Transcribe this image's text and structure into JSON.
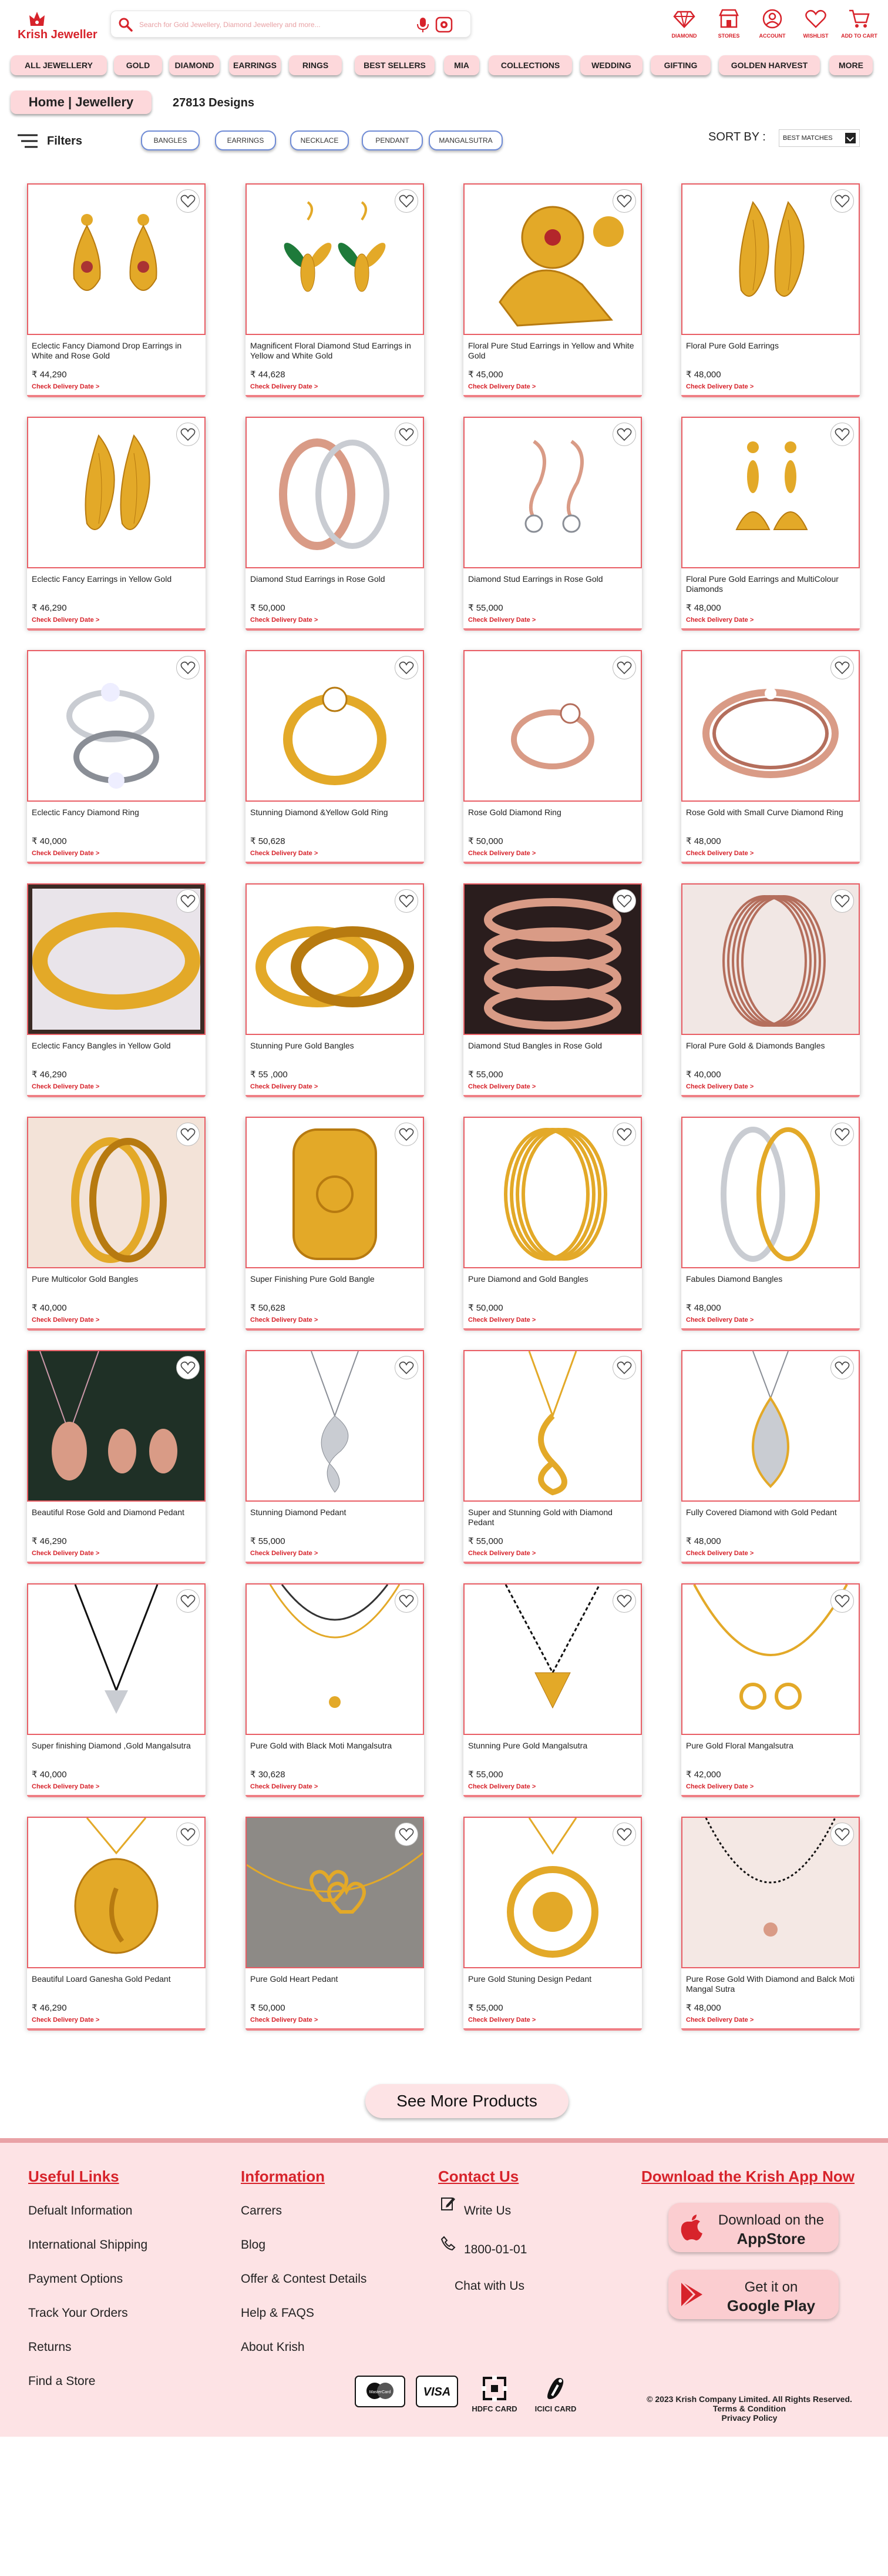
{
  "header": {
    "logo_text": "Krish Jeweller",
    "search_placeholder": "Search for Gold Jewellery, Diamond Jewellery and more...",
    "nav": [
      {
        "label": "DIAMOND",
        "icon": "diamond-icon"
      },
      {
        "label": "STORES",
        "icon": "store-icon"
      },
      {
        "label": "ACCOUNT",
        "icon": "account-icon"
      },
      {
        "label": "WISHLIST",
        "icon": "heart-icon"
      },
      {
        "label": "ADD TO CART",
        "icon": "cart-icon"
      }
    ]
  },
  "categories": [
    "ALL JEWELLERY",
    "GOLD",
    "DIAMOND",
    "EARRINGS",
    "RINGS",
    "BEST SELLERS",
    "MIA",
    "COLLECTIONS",
    "WEDDING",
    "GIFTING",
    "GOLDEN HARVEST",
    "MORE"
  ],
  "breadcrumb": "Home | Jewellery",
  "designs_count": "27813 Designs",
  "filters": {
    "label": "Filters",
    "chips": [
      "BANGLES",
      "EARRINGS",
      "NECKLACE",
      "PENDANT",
      "MANGALSUTRA"
    ]
  },
  "sort": {
    "label": "SORT BY :",
    "selected": "BEST MATCHES"
  },
  "delivery_text": "Check Delivery Date >",
  "currency": "₹",
  "products": [
    {
      "name": "Eclectic Fancy Diamond Drop Earrings in White and Rose Gold",
      "price": "44,290",
      "type": "earring-drop",
      "bg": "#ffffff"
    },
    {
      "name": "Magnificent Floral Diamond Stud Earrings in Yellow and White Gold",
      "price": "44,628",
      "type": "earring-leaf",
      "bg": "#ffffff"
    },
    {
      "name": "Floral Pure Stud Earrings in Yellow and White Gold",
      "price": "45,000",
      "type": "earring-jhumka",
      "bg": "#ffffff"
    },
    {
      "name": "Floral Pure Gold Earrings",
      "price": "48,000",
      "type": "earring-feather",
      "bg": "#ffffff"
    },
    {
      "name": "Eclectic Fancy Earrings in Yellow Gold",
      "price": "46,290",
      "type": "earring-feather",
      "bg": "#ffffff"
    },
    {
      "name": "Diamond Stud Earrings in Rose Gold",
      "price": "50,000",
      "type": "earring-hoop",
      "bg": "#ffffff"
    },
    {
      "name": "Diamond Stud Earrings in Rose Gold",
      "price": "55,000",
      "type": "earring-hook",
      "bg": "#ffffff"
    },
    {
      "name": "Floral Pure Gold Earrings and MultiColour Diamonds",
      "price": "48,000",
      "type": "earring-jhumka-small",
      "bg": "#ffffff"
    },
    {
      "name": "Eclectic Fancy Diamond Ring",
      "price": "40,000",
      "type": "ring-silver",
      "bg": "#ffffff"
    },
    {
      "name": "Stunning Diamond &Yellow Gold Ring",
      "price": "50,628",
      "type": "ring-gold",
      "bg": "#ffffff"
    },
    {
      "name": "Rose Gold Diamond Ring",
      "price": "50,000",
      "type": "ring-rose",
      "bg": "#ffffff"
    },
    {
      "name": "Rose Gold with Small Curve Diamond Ring",
      "price": "48,000",
      "type": "ring-rose-band",
      "bg": "#ffffff"
    },
    {
      "name": "Eclectic Fancy Bangles in Yellow Gold",
      "price": "46,290",
      "type": "bangle-dark",
      "bg": "#e9e4ea"
    },
    {
      "name": "Stunning Pure Gold Bangles",
      "price": "55 ,000",
      "type": "bangle-pair",
      "bg": "#ffffff"
    },
    {
      "name": "Diamond Stud Bangles in Rose Gold",
      "price": "55,000",
      "type": "bangle-rose-stack",
      "bg": "#2a1d1d"
    },
    {
      "name": "Floral Pure Gold & Diamonds Bangles",
      "price": "40,000",
      "type": "bangle-rose-thin",
      "bg": "#f1e7e4"
    },
    {
      "name": "Pure Multicolor Gold Bangles",
      "price": "40,000",
      "type": "bangle-pair-soft",
      "bg": "#f3e3d8"
    },
    {
      "name": "Super Finishing Pure Gold Bangle",
      "price": "50,628",
      "type": "bangle-wide",
      "bg": "#ffffff"
    },
    {
      "name": "Pure Diamond  and Gold Bangles",
      "price": "50,000",
      "type": "bangle-stack",
      "bg": "#ffffff"
    },
    {
      "name": "Fabules Diamond Bangles",
      "price": "48,000",
      "type": "bangle-diamond",
      "bg": "#ffffff"
    },
    {
      "name": "Beautiful Rose Gold and Diamond Pedant",
      "price": "46,290",
      "type": "pendant-dark",
      "bg": "#1f3026"
    },
    {
      "name": "Stunning Diamond Pedant",
      "price": "55,000",
      "type": "pendant-silver",
      "bg": "#ffffff"
    },
    {
      "name": "Super and Stunning Gold with Diamond Pedant",
      "price": "55,000",
      "type": "pendant-gold",
      "bg": "#ffffff"
    },
    {
      "name": "Fully Covered Diamond with Gold Pedant",
      "price": "48,000",
      "type": "pendant-drop",
      "bg": "#ffffff"
    },
    {
      "name": "Super finishing Diamond ,Gold Mangalsutra",
      "price": "40,000",
      "type": "mangal-v",
      "bg": "#ffffff"
    },
    {
      "name": "Pure Gold with Black Moti Mangalsutra",
      "price": "30,628",
      "type": "mangal-chain",
      "bg": "#ffffff"
    },
    {
      "name": "Stunning Pure Gold Mangalsutra",
      "price": "55,000",
      "type": "mangal-gold",
      "bg": "#ffffff"
    },
    {
      "name": "Pure Gold Floral Mangalsutra",
      "price": "42,000",
      "type": "mangal-floral",
      "bg": "#ffffff"
    },
    {
      "name": "Beautiful Loard Ganesha Gold Pedant",
      "price": "46,290",
      "type": "pendant-ganesha",
      "bg": "#ffffff"
    },
    {
      "name": "Pure Gold Heart Pedant",
      "price": "50,000",
      "type": "pendant-heart",
      "bg": "#8d8a86"
    },
    {
      "name": "Pure Gold Stuning Design Pedant",
      "price": "55,000",
      "type": "pendant-round",
      "bg": "#ffffff"
    },
    {
      "name": "Pure Rose Gold With Diamond and Balck Moti Mangal Sutra",
      "price": "48,000",
      "type": "mangal-rose",
      "bg": "#f4e8e4"
    }
  ],
  "see_more": "See More Products",
  "footer": {
    "useful_links": {
      "title": "Useful Links",
      "items": [
        "Defualt Information",
        "International Shipping",
        "Payment Options",
        "Track Your Orders",
        "Returns",
        "Find a Store"
      ]
    },
    "information": {
      "title": "Information",
      "items": [
        "Carrers",
        "Blog",
        "Offer & Contest Details",
        "Help & FAQS",
        "About Krish"
      ]
    },
    "contact": {
      "title": "Contact Us",
      "write": "Write Us",
      "phone": "1800-01-01",
      "chat": "Chat with Us"
    },
    "app": {
      "title": "Download the Krish App Now",
      "appstore_1": "Download on the",
      "appstore_2": "AppStore",
      "play_1": "Get it on",
      "play_2": "Google Play"
    },
    "payments": {
      "card1": "MasterCard",
      "card2": "VISA",
      "hdfc": "HDFC CARD",
      "icici": "ICICI CARD"
    },
    "copyright": "© 2023 Krish Company Limited. All Rights Reserved.",
    "terms": "Terms & Condition",
    "privacy": "Privacy Policy"
  },
  "colors": {
    "brand": "#d7232b",
    "pink": "#fdd8db",
    "footer_bg": "#fde3e5"
  }
}
